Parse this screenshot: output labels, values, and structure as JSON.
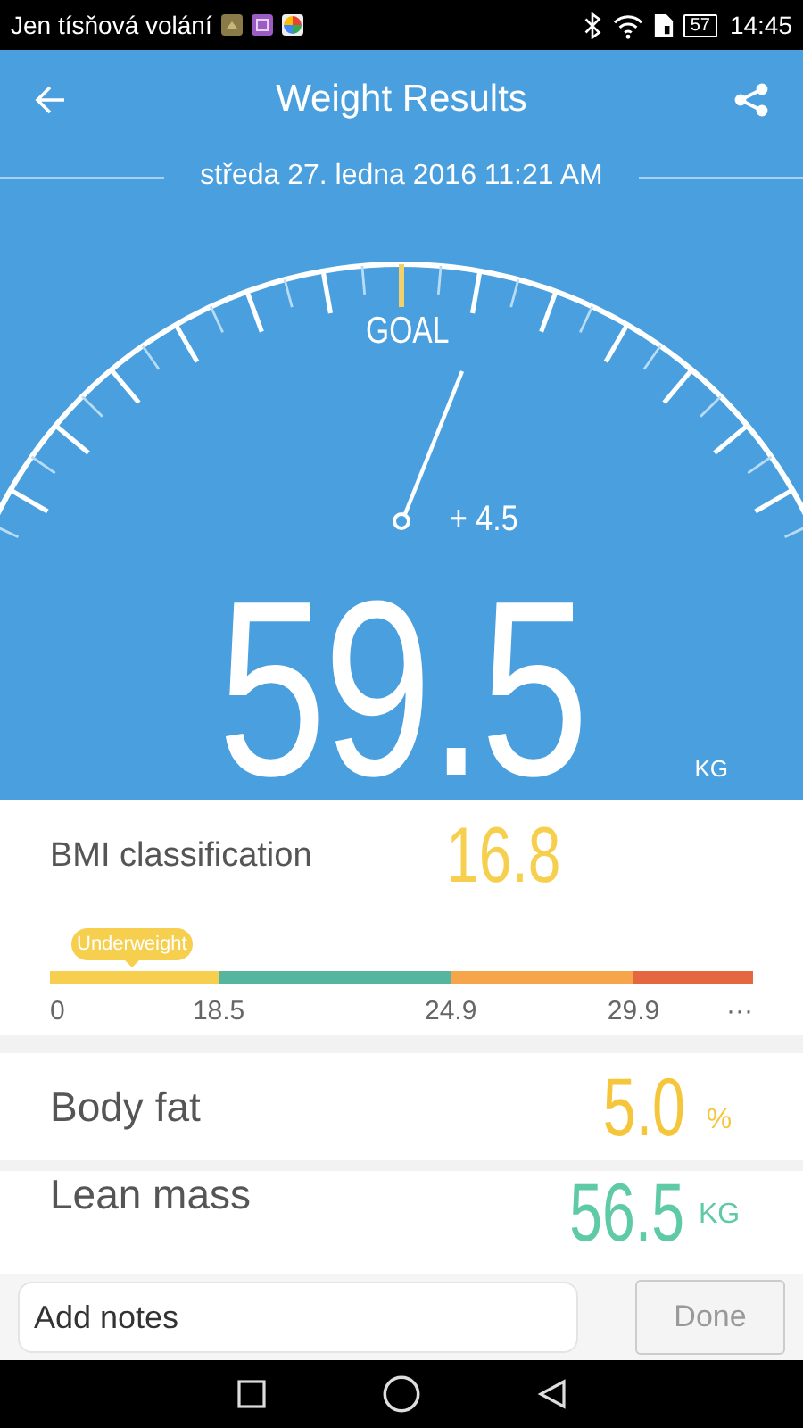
{
  "status_bar": {
    "carrier": "Jen tísňová volání",
    "battery": "57",
    "time": "14:45"
  },
  "header": {
    "title": "Weight Results",
    "date": "středa 27. ledna 2016 11:21 AM"
  },
  "gauge": {
    "goal_label": "GOAL",
    "difference": "+ 4.5"
  },
  "weight": {
    "value": "59.5",
    "unit": "KG"
  },
  "bmi": {
    "label": "BMI classification",
    "value": "16.8",
    "marker": {
      "text": "Underweight"
    },
    "segments": [
      {
        "color": "#f7cf4f"
      },
      {
        "color": "#56b59f"
      },
      {
        "color": "#f6a54a"
      },
      {
        "color": "#e5673f"
      }
    ],
    "scale_labels": [
      "0",
      "18.5",
      "24.9",
      "29.9",
      "···"
    ]
  },
  "metrics": [
    {
      "label": "Body fat",
      "value": "5.0",
      "unit": "%",
      "color": "#f5c63c"
    },
    {
      "label": "Lean mass",
      "value": "56.5",
      "unit": "KG",
      "color": "#5fcaa6"
    }
  ],
  "notes": {
    "placeholder": "Add notes",
    "button": "Done"
  }
}
